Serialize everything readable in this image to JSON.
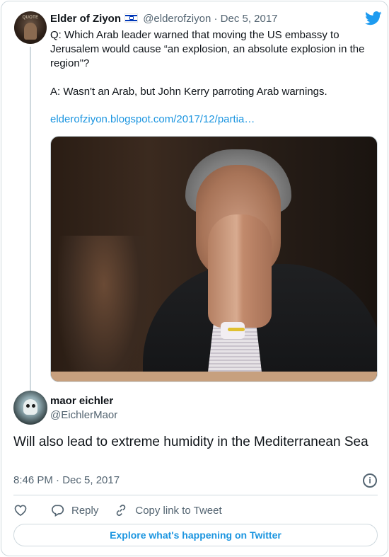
{
  "parent_tweet": {
    "avatar_text": "QUOTE",
    "author_name": "Elder of Ziyon",
    "flag": "israel-flag",
    "handle": "@elderofziyon",
    "separator": "·",
    "date": "Dec 5, 2017",
    "text_q": "Q: Which Arab leader warned that moving the US embassy to Jerusalem would  cause “an explosion, an absolute explosion in the region\"?",
    "text_a": "A: Wasn't an Arab, but John Kerry parroting Arab warnings.",
    "link": "elderofziyon.blogspot.com/2017/12/partia…",
    "photo": "man-with-hands-over-face-photo"
  },
  "reply_tweet": {
    "author_name": "maor eichler",
    "handle": "@EichlerMaor",
    "text": "Will also lead to extreme humidity in the Mediterranean Sea",
    "timestamp": "8:46 PM · Dec 5, 2017"
  },
  "actions": {
    "reply_label": "Reply",
    "copy_link_label": "Copy link to Tweet"
  },
  "explore_label": "Explore what's happening on Twitter",
  "colors": {
    "link": "#1b95e0",
    "muted": "#536471",
    "border": "#cfd9de",
    "twitter_blue": "#1d9bf0"
  }
}
